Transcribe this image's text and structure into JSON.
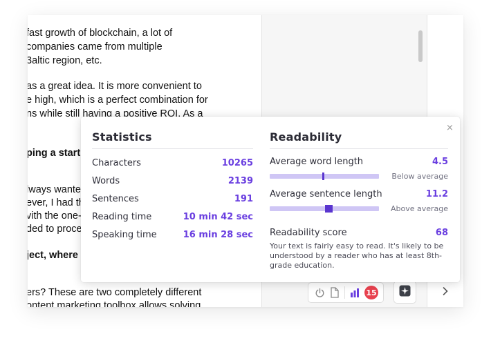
{
  "document": {
    "lines": [
      {
        "text": "fast growth of blockchain, a lot of",
        "bold": false
      },
      {
        "text": "companies came from multiple",
        "bold": false
      },
      {
        "text": "3altic region, etc.",
        "bold": false
      },
      {
        "text": "as a great idea. It is more convenient to",
        "bold": false
      },
      {
        "text": "e high, which is a perfect combination for",
        "bold": false
      },
      {
        "text": "ns while still having a positive ROI. As a",
        "bold": false
      },
      {
        "text": "ping a startu",
        "bold": true
      },
      {
        "text": "lways wanted",
        "bold": false
      },
      {
        "text": "ever, I had thi",
        "bold": false
      },
      {
        "text": "vith the one--",
        "bold": false
      },
      {
        "text": "ded to proce",
        "bold": false
      },
      {
        "text": "ject, where i",
        "bold": true
      },
      {
        "text": "ers? These are two completely different",
        "bold": false
      },
      {
        "text": "ontent marketing toolbox allows solving",
        "bold": false
      }
    ]
  },
  "toolbar": {
    "power_icon": "power-icon",
    "doc_icon": "document-icon",
    "stats_icon": "bar-chart-icon",
    "issues_count": "15",
    "assistant_icon": "sparkle-icon",
    "next_icon": "chevron-right-icon"
  },
  "popup": {
    "close_label": "×",
    "statistics": {
      "title": "Statistics",
      "rows": [
        {
          "label": "Characters",
          "value": "10265"
        },
        {
          "label": "Words",
          "value": "2139"
        },
        {
          "label": "Sentences",
          "value": "191"
        },
        {
          "label": "Reading time",
          "value": "10 min 42 sec"
        },
        {
          "label": "Speaking time",
          "value": "16 min 28 sec"
        }
      ]
    },
    "readability": {
      "title": "Readability",
      "word_length": {
        "label": "Average word length",
        "value": "4.5",
        "note": "Below average",
        "marker_position": 0.49
      },
      "sentence_length": {
        "label": "Average sentence length",
        "value": "11.2",
        "note": "Above average",
        "marker_position": 0.54
      },
      "score": {
        "label": "Readability score",
        "value": "68",
        "description": "Your text is fairly easy to read. It's likely to be understood by a reader who has at least 8th-grade education."
      }
    }
  },
  "colors": {
    "accent": "#6a3fe0",
    "bar_track": "#cfc6f5",
    "bar_marker": "#5a35cf",
    "badge": "#e8414e",
    "stats_icon": "#6a3fe0"
  }
}
